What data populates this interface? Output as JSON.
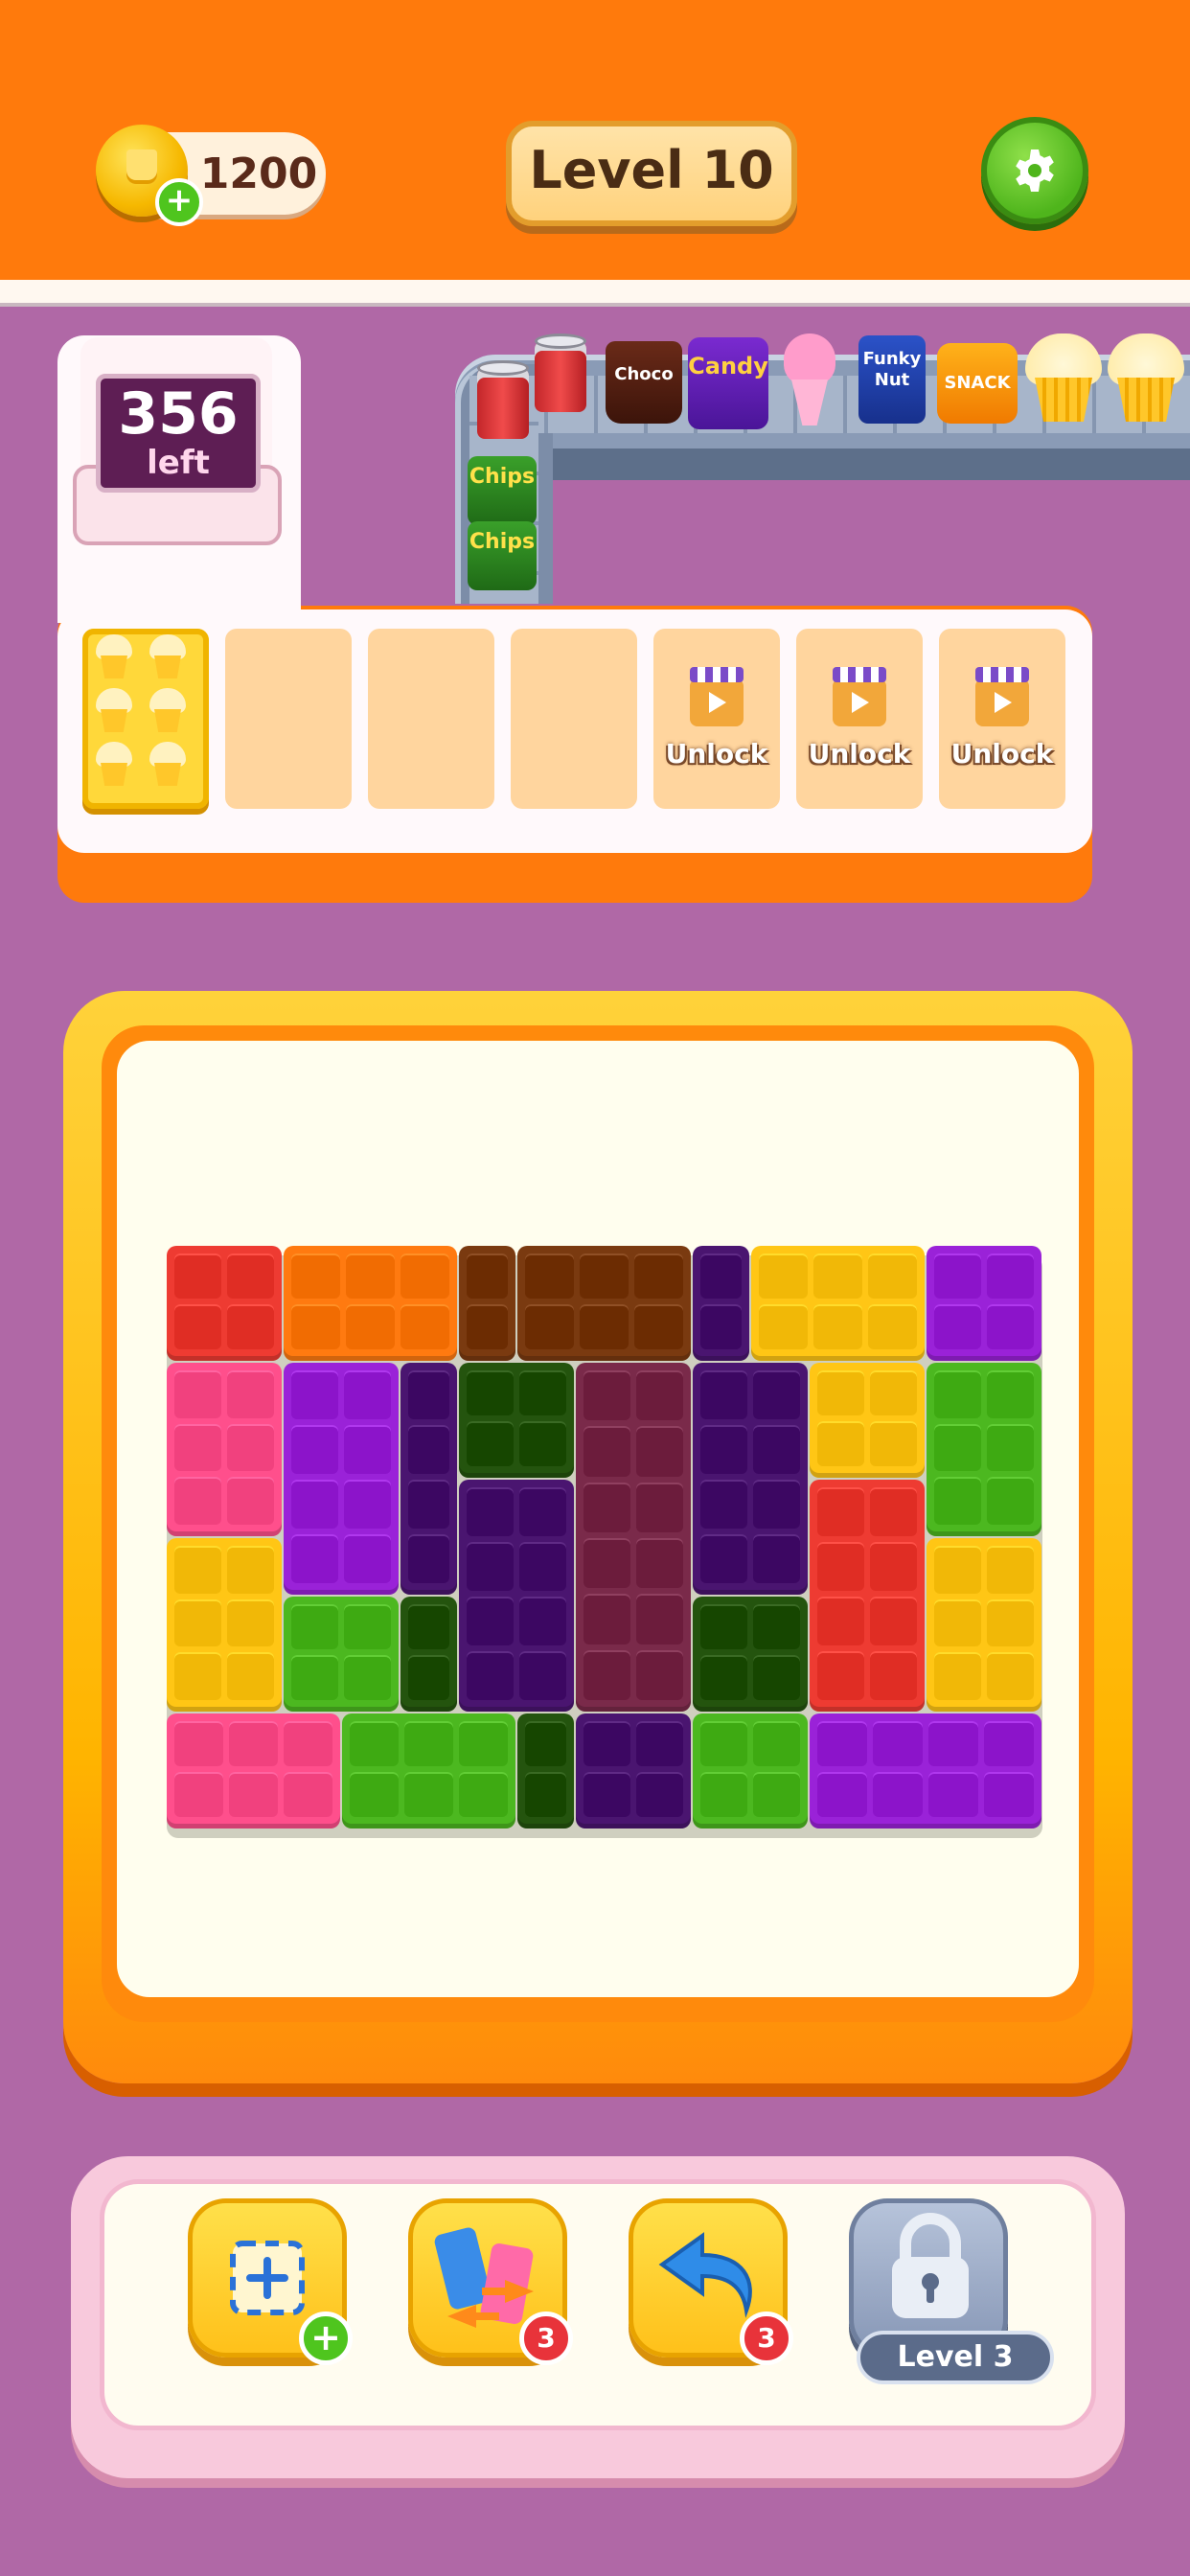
{
  "header": {
    "coins": "1200",
    "level": "Level 10"
  },
  "counter": {
    "count": "356",
    "label": "left"
  },
  "conveyor": {
    "labels": {
      "choco": "Choco",
      "candy": "Candy",
      "funky": "Funky Nut",
      "snack": "SNACK",
      "chips": "Chips"
    }
  },
  "storage": {
    "unlock_label": "Unlock",
    "slots_total": 7,
    "slots_filled": 1,
    "slots_locked": 3
  },
  "toolbar": {
    "shuffle_count": "3",
    "undo_count": "3",
    "locked_label": "Level 3"
  },
  "colors": {
    "background": "#b068a6",
    "header": "#ff7a0c",
    "red": "#ee3b32",
    "orange": "#ff7a10",
    "brown": "#7a3a10",
    "darkpurple": "#4a1570",
    "yellow": "#ffc615",
    "purple": "#9a22d8",
    "pink": "#ff4f8c",
    "green": "#4cb820",
    "darkgreen": "#24540e",
    "maroon": "#7a2a4a"
  }
}
